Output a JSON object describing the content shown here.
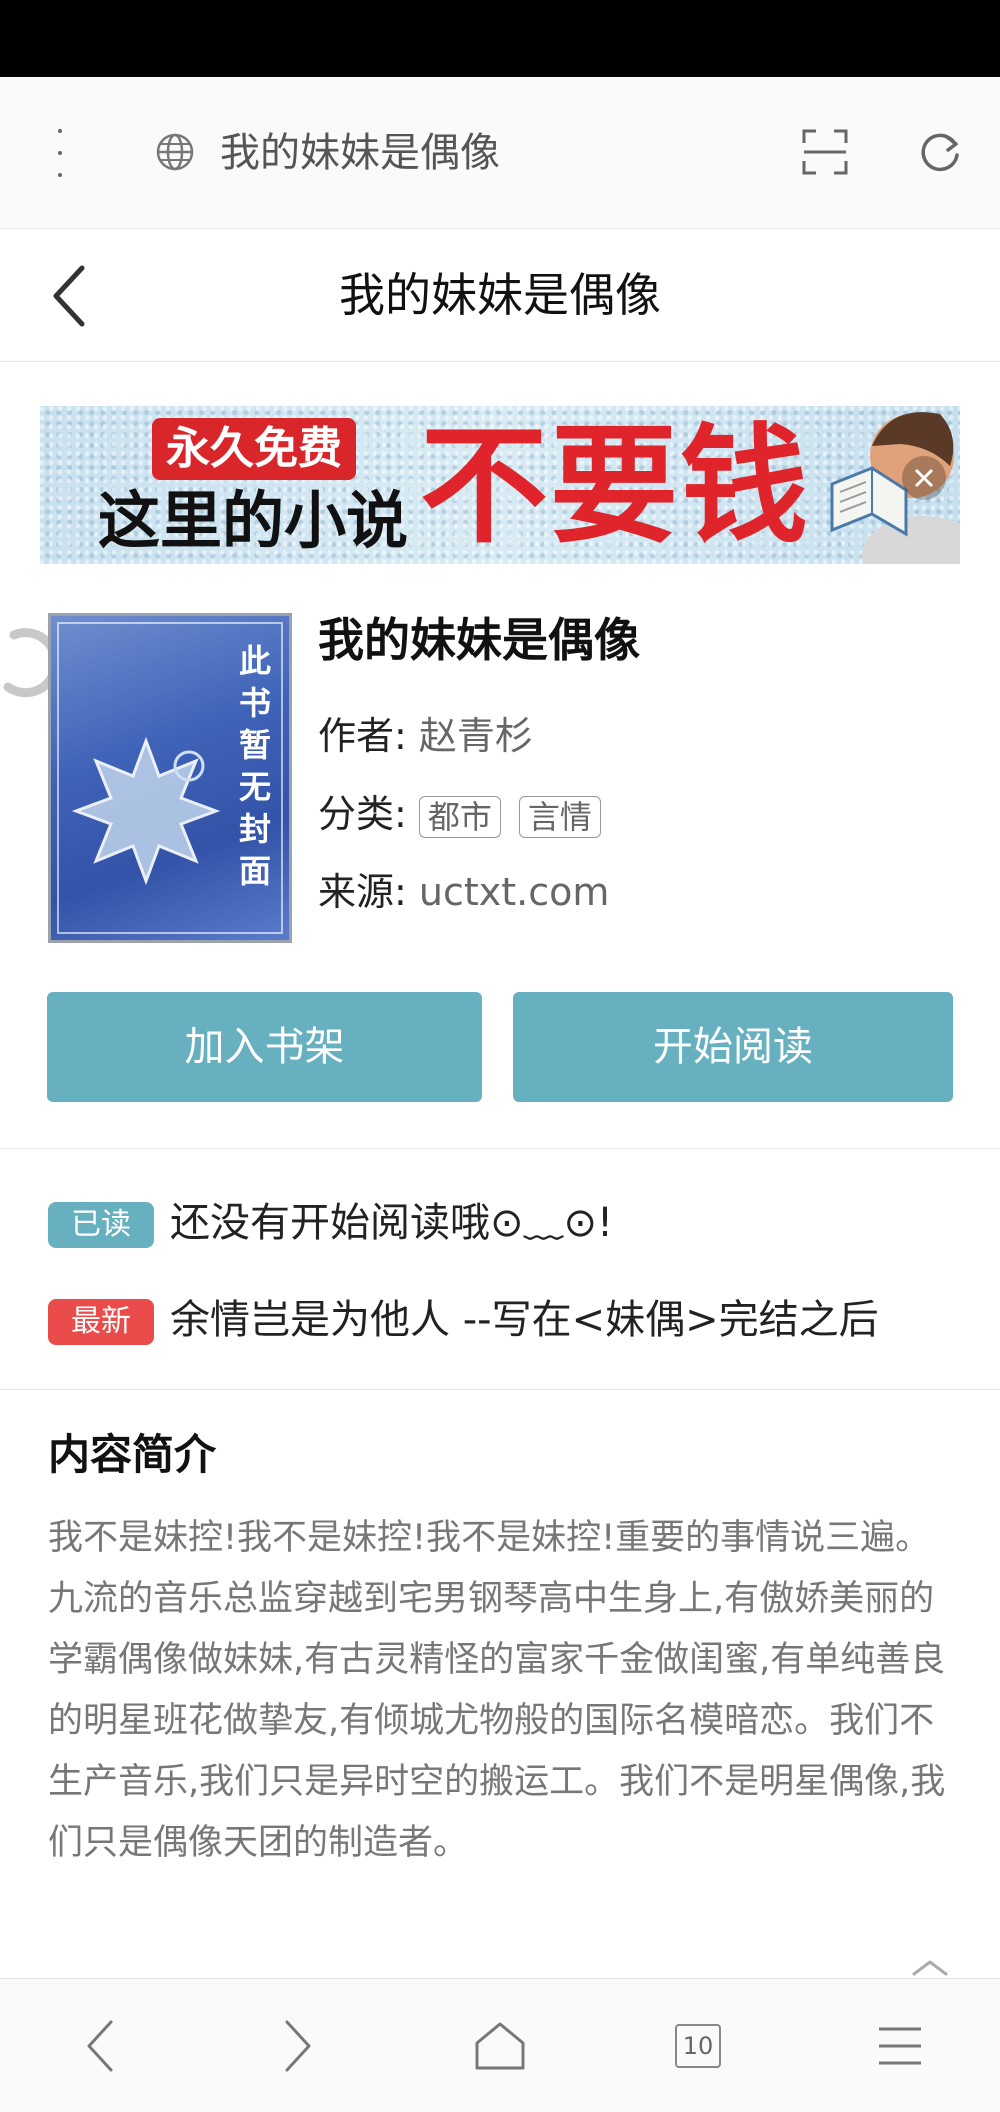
{
  "browser": {
    "url_title": "我的妹妹是偶像",
    "icons": [
      "more-dots-icon",
      "globe-icon",
      "scan-icon",
      "reload-icon"
    ]
  },
  "header": {
    "title": "我的妹妹是偶像",
    "back_icon": "back-chevron-icon"
  },
  "ad": {
    "badge": "永久免费",
    "line2": "这里的小说",
    "big_text": "不要钱",
    "close_icon": "close-icon"
  },
  "book": {
    "cover_text": "此书暂无封面",
    "title": "我的妹妹是偶像",
    "author_label": "作者:",
    "author": "赵青杉",
    "category_label": "分类:",
    "categories": [
      "都市",
      "言情"
    ],
    "source_label": "来源:",
    "source": "uctxt.com"
  },
  "actions": {
    "add_shelf": "加入书架",
    "start_read": "开始阅读"
  },
  "status": {
    "read_badge": "已读",
    "read_text": "还没有开始阅读哦⊙﹏⊙!",
    "latest_badge": "最新",
    "latest_text": "余情岂是为他人 --写在<妹偶>完结之后"
  },
  "intro": {
    "title": "内容简介",
    "text": "我不是妹控!我不是妹控!我不是妹控!重要的事情说三遍。九流的音乐总监穿越到宅男钢琴高中生身上,有傲娇美丽的学霸偶像做妹妹,有古灵精怪的富家千金做闺蜜,有单纯善良的明星班花做挚友,有倾城尤物般的国际名模暗恋。我们不生产音乐,我们只是异时空的搬运工。我们不是明星偶像,我们只是偶像天团的制造者。"
  },
  "bottom_nav": {
    "tab_count": "10",
    "icons": [
      "back-icon",
      "forward-icon",
      "home-icon",
      "tabs-icon",
      "menu-icon"
    ]
  },
  "colors": {
    "accent": "#66b0c0",
    "new_badge": "#ea4b4b",
    "ad_red": "#e0242b"
  }
}
